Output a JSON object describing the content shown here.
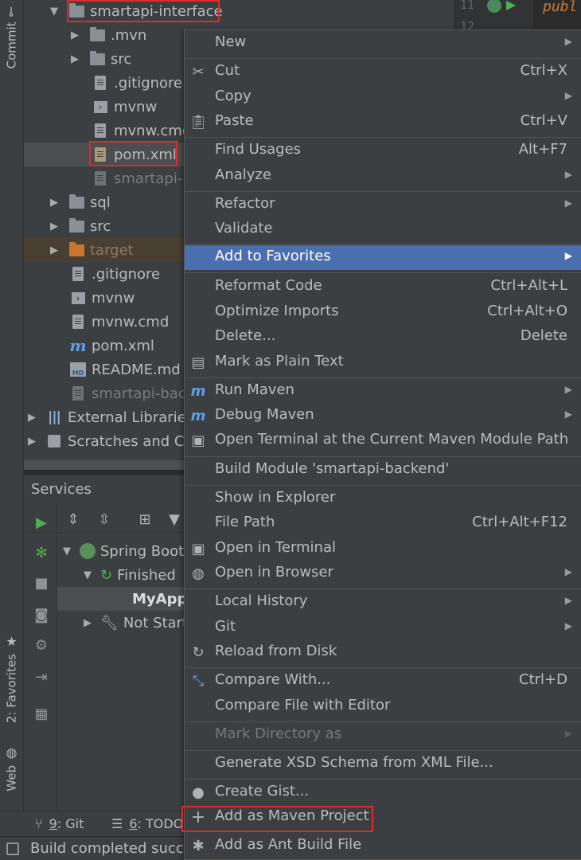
{
  "left_strip": {
    "commit": "Commit",
    "favorites": "2: Favorites",
    "web": "Web"
  },
  "editor": {
    "line_11": "11",
    "line_12": "12",
    "code": "publ"
  },
  "tree": {
    "rows": [
      {
        "label": "smartapi-interface"
      },
      {
        "label": ".mvn"
      },
      {
        "label": "src"
      },
      {
        "label": ".gitignore"
      },
      {
        "label": "mvnw"
      },
      {
        "label": "mvnw.cmd"
      },
      {
        "label": "pom.xml"
      },
      {
        "label": "smartapi-interface.iml"
      },
      {
        "label": "sql"
      },
      {
        "label": "src"
      },
      {
        "label": "target"
      },
      {
        "label": ".gitignore"
      },
      {
        "label": "mvnw"
      },
      {
        "label": "mvnw.cmd"
      },
      {
        "label": "pom.xml"
      },
      {
        "label": "README.md"
      },
      {
        "label": "smartapi-backend.iml"
      },
      {
        "label": "External Libraries"
      },
      {
        "label": "Scratches and Consoles"
      }
    ]
  },
  "services": {
    "title": "Services",
    "rows": [
      {
        "label": "Spring Boot"
      },
      {
        "label": "Finished"
      },
      {
        "label": "MyApplication"
      },
      {
        "label": "Not Started"
      }
    ]
  },
  "bottom_tabs": {
    "git_num": "9",
    "git_label": ": Git",
    "todo_num": "6",
    "todo_label": ": TODO"
  },
  "status": {
    "text": "Build completed successfully"
  },
  "menu": {
    "items": [
      {
        "label": "New",
        "shortcut": ""
      },
      {
        "label": "Cut",
        "shortcut": "Ctrl+X"
      },
      {
        "label": "Copy",
        "shortcut": ""
      },
      {
        "label": "Paste",
        "shortcut": "Ctrl+V"
      },
      {
        "label": "Find Usages",
        "shortcut": "Alt+F7"
      },
      {
        "label": "Analyze",
        "shortcut": ""
      },
      {
        "label": "Refactor",
        "shortcut": ""
      },
      {
        "label": "Validate",
        "shortcut": ""
      },
      {
        "label": "Add to Favorites",
        "shortcut": ""
      },
      {
        "label": "Reformat Code",
        "shortcut": "Ctrl+Alt+L"
      },
      {
        "label": "Optimize Imports",
        "shortcut": "Ctrl+Alt+O"
      },
      {
        "label": "Delete...",
        "shortcut": "Delete"
      },
      {
        "label": "Mark as Plain Text",
        "shortcut": ""
      },
      {
        "label": "Run Maven",
        "shortcut": ""
      },
      {
        "label": "Debug Maven",
        "shortcut": ""
      },
      {
        "label": "Open Terminal at the Current Maven Module Path",
        "shortcut": ""
      },
      {
        "label": "Build Module 'smartapi-backend'",
        "shortcut": ""
      },
      {
        "label": "Show in Explorer",
        "shortcut": ""
      },
      {
        "label": "File Path",
        "shortcut": "Ctrl+Alt+F12"
      },
      {
        "label": "Open in Terminal",
        "shortcut": ""
      },
      {
        "label": "Open in Browser",
        "shortcut": ""
      },
      {
        "label": "Local History",
        "shortcut": ""
      },
      {
        "label": "Git",
        "shortcut": ""
      },
      {
        "label": "Reload from Disk",
        "shortcut": ""
      },
      {
        "label": "Compare With...",
        "shortcut": "Ctrl+D"
      },
      {
        "label": "Compare File with Editor",
        "shortcut": ""
      },
      {
        "label": "Mark Directory as",
        "shortcut": ""
      },
      {
        "label": "Generate XSD Schema from XML File...",
        "shortcut": ""
      },
      {
        "label": "Create Gist...",
        "shortcut": ""
      },
      {
        "label": "Add as Maven Project",
        "shortcut": ""
      },
      {
        "label": "Add as Ant Build File",
        "shortcut": ""
      }
    ]
  },
  "colors": {
    "background": "#3c3f41",
    "menu_hover": "#4b6eaf",
    "highlight_box": "#e02b2b",
    "maven_blue": "#5f9ee8",
    "run_green": "#4caf50"
  }
}
